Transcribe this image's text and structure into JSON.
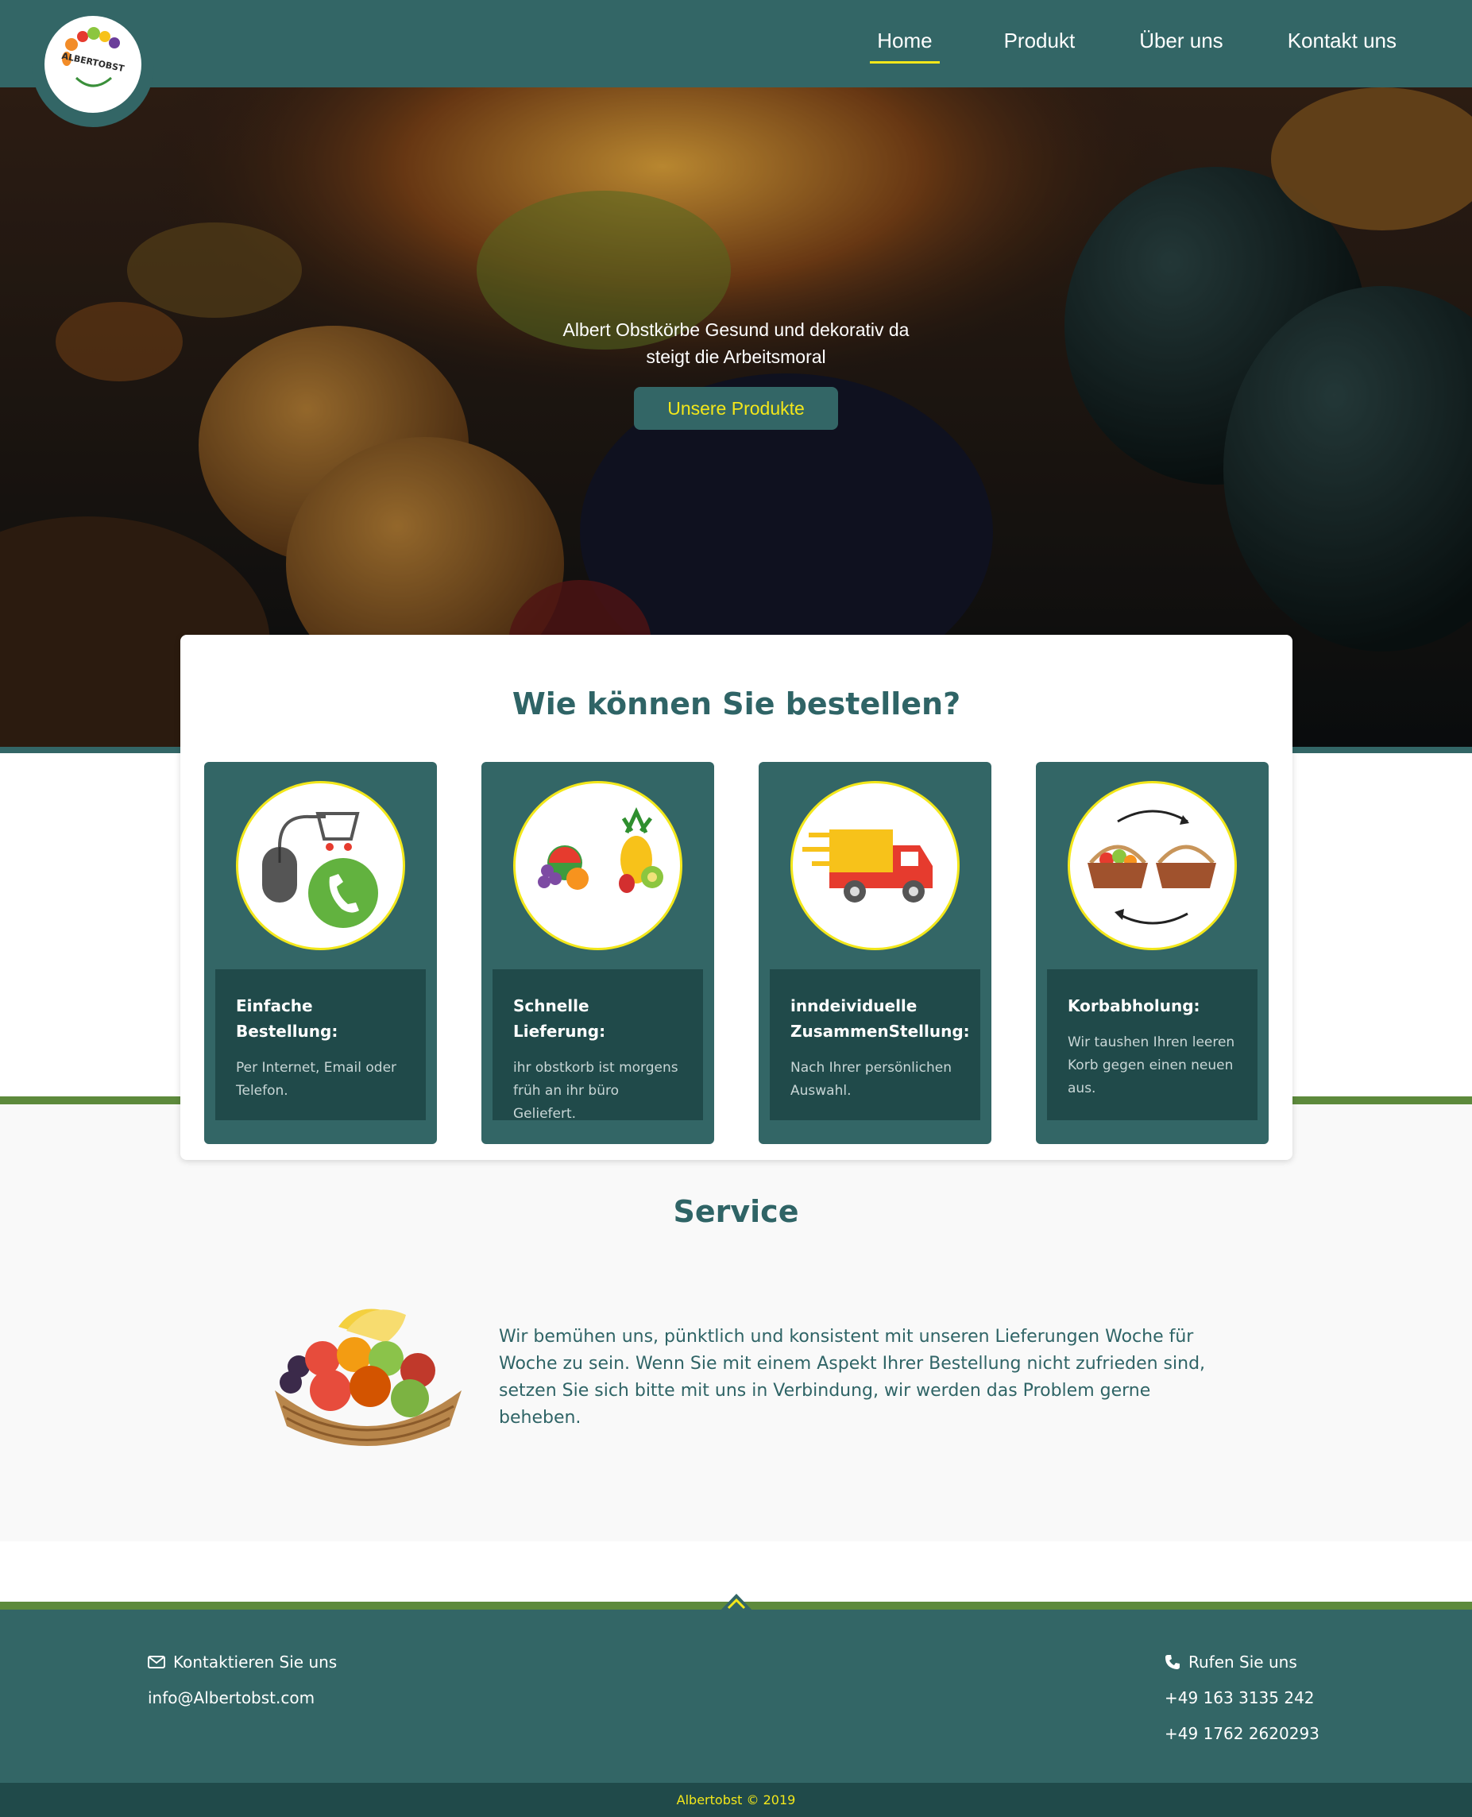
{
  "header": {
    "logo_text": "ALBERTOBST",
    "nav": [
      {
        "label": "Home",
        "active": true
      },
      {
        "label": "Produkt",
        "active": false
      },
      {
        "label": "Über uns",
        "active": false
      },
      {
        "label": "Kontakt uns",
        "active": false
      }
    ]
  },
  "hero": {
    "line1": "Albert Obstkörbe Gesund und dekorativ da",
    "line2": "steigt die Arbeitsmoral",
    "button": "Unsere Produkte"
  },
  "order": {
    "title": "Wie können Sie bestellen?",
    "steps": [
      {
        "title": "Einfache Bestellung:",
        "desc": "Per Internet, Email oder Telefon.",
        "icon": "mouse-cart-phone-icon"
      },
      {
        "title": "Schnelle Lieferung:",
        "desc": "ihr obstkorb ist morgens früh an ihr büro Geliefert.",
        "icon": "fruits-icon"
      },
      {
        "title": "inndeividuelle ZusammenStellung:",
        "desc": "Nach Ihrer persönlichen Auswahl.",
        "icon": "delivery-truck-icon"
      },
      {
        "title": "Korbabholung:",
        "desc": "Wir taushen Ihren leeren Korb gegen einen neuen aus.",
        "icon": "basket-swap-icon"
      }
    ]
  },
  "service": {
    "title": "Service",
    "text": "Wir bemühen uns, pünktlich und konsistent mit unseren Lieferungen Woche für Woche zu sein. Wenn Sie mit einem Aspekt Ihrer Bestellung nicht zufrieden sind, setzen Sie sich bitte mit uns in Verbindung, wir werden das Problem gerne beheben."
  },
  "footer": {
    "contact_label": "Kontaktieren Sie uns",
    "email": "info@Albertobst.com",
    "call_label": "Rufen Sie uns",
    "phone1": "+49 163 3135 242",
    "phone2": "+49 1762 2620293",
    "copyright": "Albertobst © 2019"
  },
  "colors": {
    "primary": "#336666",
    "dark": "#204a4a",
    "accent": "#f3e71a",
    "green": "#5d8a3c"
  }
}
